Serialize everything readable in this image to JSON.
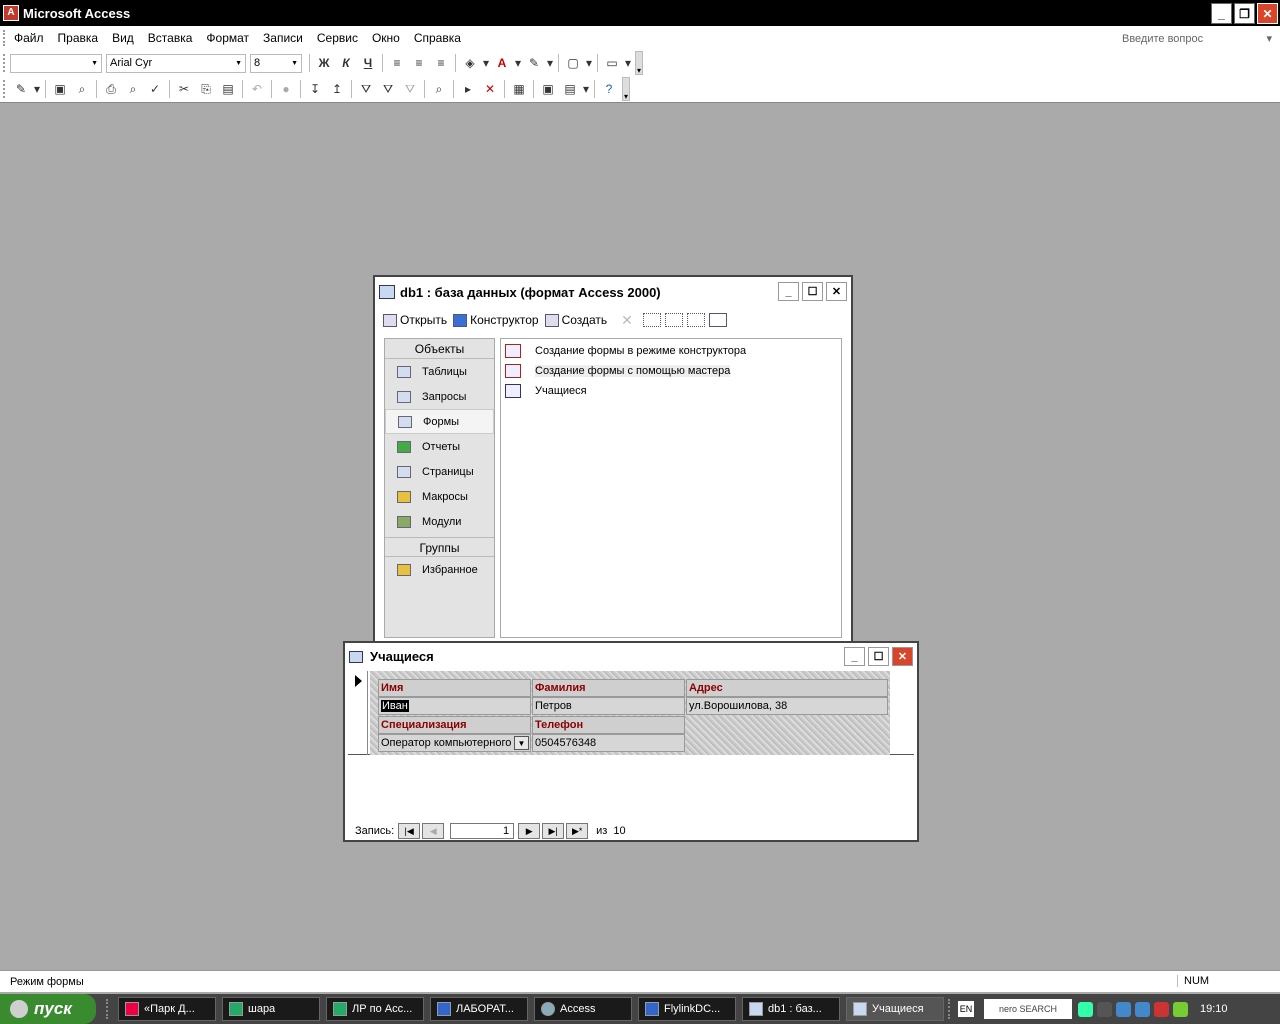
{
  "app": {
    "title": "Microsoft Access",
    "icon": "access-key-icon",
    "window_buttons": [
      "minimize",
      "restore",
      "close"
    ]
  },
  "menu": {
    "items": [
      "Файл",
      "Правка",
      "Вид",
      "Вставка",
      "Формат",
      "Записи",
      "Сервис",
      "Окно",
      "Справка"
    ],
    "help_placeholder": "Введите вопрос"
  },
  "toolbar1": {
    "object_combo": "",
    "font_name": "Arial Cyr",
    "font_size": "8",
    "bold": "Ж",
    "italic": "К",
    "underline": "Ч"
  },
  "db_window": {
    "title": "db1 : база данных (формат Access 2000)",
    "toolbar": [
      "Открыть",
      "Конструктор",
      "Создать"
    ],
    "objects_header": "Объекты",
    "objects": [
      "Таблицы",
      "Запросы",
      "Формы",
      "Отчеты",
      "Страницы",
      "Макросы",
      "Модули"
    ],
    "selected_object": "Формы",
    "groups_header": "Группы",
    "groups": [
      "Избранное"
    ],
    "list": [
      "Создание формы в режиме конструктора",
      "Создание формы с помощью мастера",
      "Учащиеся"
    ]
  },
  "form_window": {
    "title": "Учащиеся",
    "fields": {
      "name_label": "Имя",
      "surname_label": "Фамилия",
      "address_label": "Адрес",
      "name_value": "Иван",
      "surname_value": "Петров",
      "address_value": "ул.Ворошилова, 38",
      "spec_label": "Специализация",
      "phone_label": "Телефон",
      "spec_value": "Оператор компьютерного",
      "phone_value": "0504576348"
    },
    "nav": {
      "label": "Запись:",
      "current": "1",
      "of": "из",
      "total": "10"
    }
  },
  "status": {
    "text": "Режим формы",
    "num": "NUM"
  },
  "taskbar": {
    "start": "пуск",
    "tasks": [
      "«Парк Д...",
      "шара",
      "ЛР по Acc...",
      "ЛАБОРАТ...",
      "Access",
      "FlylinkDC...",
      "db1 : баз...",
      "Учащиеся"
    ],
    "active_task": "Учащиеся",
    "lang": "EN",
    "nero": "nero SEARCH",
    "time": "19:10"
  }
}
